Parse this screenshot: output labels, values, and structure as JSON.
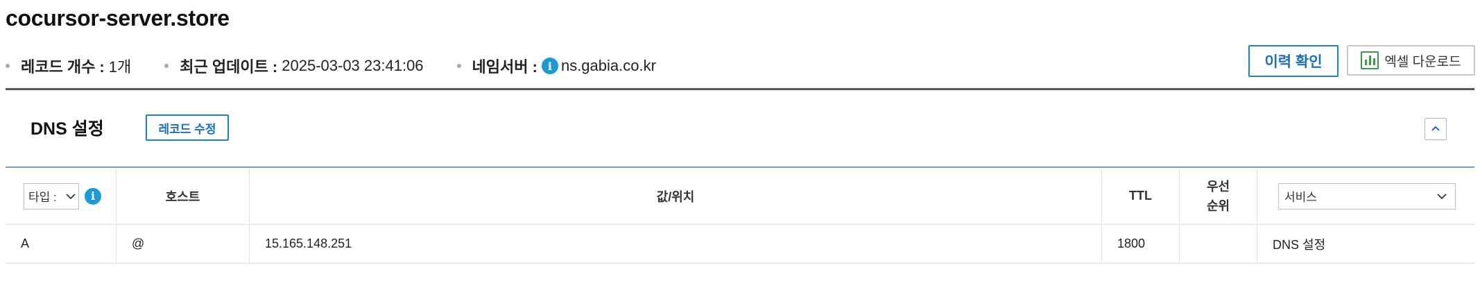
{
  "domain": "cocursor-server.store",
  "meta": {
    "record_count_label": "레코드 개수 :",
    "record_count_value": "1개",
    "last_update_label": "최근 업데이트 :",
    "last_update_value": "2025-03-03 23:41:06",
    "nameserver_label": "네임서버 :",
    "nameserver_value": "ns.gabia.co.kr"
  },
  "actions": {
    "history_label": "이력 확인",
    "excel_label": "엑셀 다운로드"
  },
  "section": {
    "title": "DNS 설정",
    "edit_label": "레코드 수정"
  },
  "table": {
    "type_select": "타입 :",
    "headers": {
      "host": "호스트",
      "value": "값/위치",
      "ttl": "TTL",
      "priority_line1": "우선",
      "priority_line2": "순위"
    },
    "service_select": "서비스",
    "rows": [
      {
        "type": "A",
        "host": "@",
        "value": "15.165.148.251",
        "ttl": "1800",
        "priority": "",
        "service": "DNS 설정"
      }
    ]
  },
  "icons": {
    "info": "info-icon",
    "excel": "spreadsheet-chart-icon",
    "collapse": "chevron-up-icon",
    "dropdown": "chevron-down-icon"
  },
  "colors": {
    "accent": "#1a82d2",
    "info": "#1c9ad6",
    "excel_green": "#3a9a4a"
  }
}
